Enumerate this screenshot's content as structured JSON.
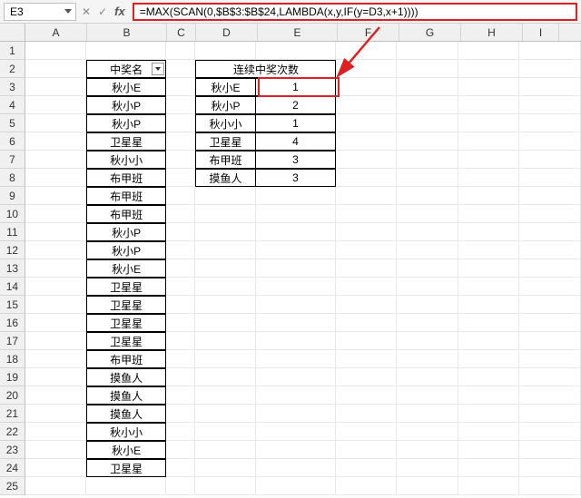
{
  "namebox": {
    "value": "E3"
  },
  "fx": {
    "cancel": "✕",
    "confirm": "✓",
    "label": "fx"
  },
  "formula": "=MAX(SCAN(0,$B$3:$B$24,LAMBDA(x,y,IF(y=D3,x+1))))",
  "columns": [
    "A",
    "B",
    "C",
    "D",
    "E",
    "F",
    "G",
    "H",
    "I"
  ],
  "row_count": 25,
  "headers": {
    "b2": "中奖名",
    "de2": "连续中奖次数"
  },
  "colB": [
    "秋小E",
    "秋小P",
    "秋小P",
    "卫星星",
    "秋小小",
    "布甲班",
    "布甲班",
    "布甲班",
    "秋小P",
    "秋小P",
    "秋小E",
    "卫星星",
    "卫星星",
    "卫星星",
    "卫星星",
    "布甲班",
    "摸鱼人",
    "摸鱼人",
    "摸鱼人",
    "秋小小",
    "秋小E",
    "卫星星"
  ],
  "colD": [
    "秋小E",
    "秋小P",
    "秋小小",
    "卫星星",
    "布甲班",
    "摸鱼人"
  ],
  "colE": [
    "1",
    "2",
    "1",
    "4",
    "3",
    "3"
  ],
  "chart_data": {
    "type": "table",
    "title": "连续中奖次数",
    "categories": [
      "秋小E",
      "秋小P",
      "秋小小",
      "卫星星",
      "布甲班",
      "摸鱼人"
    ],
    "values": [
      1,
      2,
      1,
      4,
      3,
      3
    ]
  }
}
